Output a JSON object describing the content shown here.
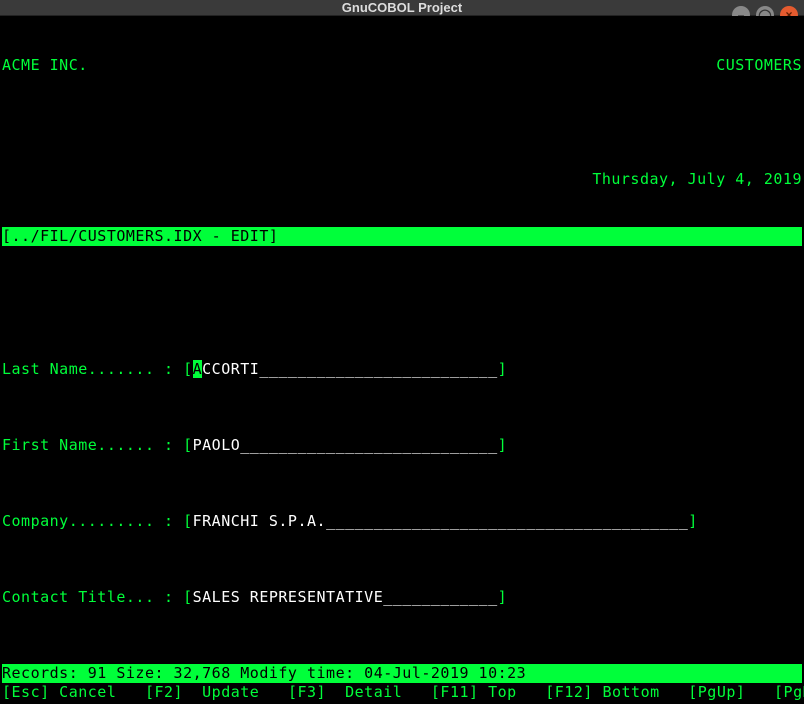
{
  "window": {
    "title": "GnuCOBOL Project"
  },
  "header": {
    "company": "ACME INC.",
    "screen": "CUSTOMERS",
    "date": "Thursday, July 4, 2019"
  },
  "file_line": "[../FIL/CUSTOMERS.IDX - EDIT]",
  "fields": {
    "last_name": {
      "label": "Last Name....... : ",
      "value_first_char": "A",
      "value_rest": "CCORTI",
      "pad": "_________________________"
    },
    "first_name": {
      "label": "First Name...... : ",
      "value": "PAOLO",
      "pad": "___________________________"
    },
    "company": {
      "label": "Company......... : ",
      "value": "FRANCHI S.P.A.",
      "pad": "______________________________________"
    },
    "contact": {
      "label": "Contact Title... : ",
      "value": "SALES REPRESENTATIVE",
      "pad": "____________"
    }
  },
  "status": {
    "records": "Records: 91 Size: 32,768 Modify time: 04-Jul-2019 10:23",
    "footer": {
      "esc": "[Esc] Cancel",
      "f2": "[F2]  Update",
      "f3": "[F3]  Detail",
      "f11": "[F11] Top",
      "f12": "[F12] Bottom",
      "pgup": "[PgUp]",
      "pgdn": "[PgDn]"
    }
  }
}
